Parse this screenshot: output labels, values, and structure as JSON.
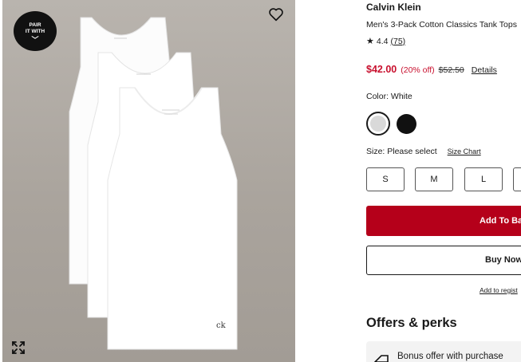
{
  "image": {
    "badge_line1": "PAIR",
    "badge_line2": "IT WITH",
    "badge_chevron": "﹀",
    "favorite_icon": "heart-icon",
    "expand_icon": "expand-arrows-icon",
    "logo_text": "ck"
  },
  "product": {
    "brand": "Calvin Klein",
    "title": "Men's 3-Pack Cotton Classics Tank Tops",
    "rating_star": "★",
    "rating": "4.4",
    "review_count": "(75)",
    "price_now": "$42.00",
    "discount": "(20% off)",
    "price_was": "$52.50",
    "details_link": "Details"
  },
  "color": {
    "label": "Color: White",
    "swatches": [
      {
        "name": "White",
        "hex": "#d9d9d9",
        "selected": true
      },
      {
        "name": "Black",
        "hex": "#111111",
        "selected": false
      }
    ]
  },
  "size": {
    "label": "Size: Please select",
    "chart_link": "Size Chart",
    "options": [
      "S",
      "M",
      "L",
      ""
    ]
  },
  "actions": {
    "add_to_bag": "Add To Ba",
    "buy_now": "Buy Now",
    "registry_link": "Add to regist"
  },
  "offers": {
    "title": "Offers & perks",
    "first_offer": "Bonus offer with purchase",
    "offer_icon": "gift-tag-icon"
  },
  "colors": {
    "sale_red": "#c8102e",
    "button_red": "#b5001a",
    "photo_bg": "#aaa49d"
  }
}
